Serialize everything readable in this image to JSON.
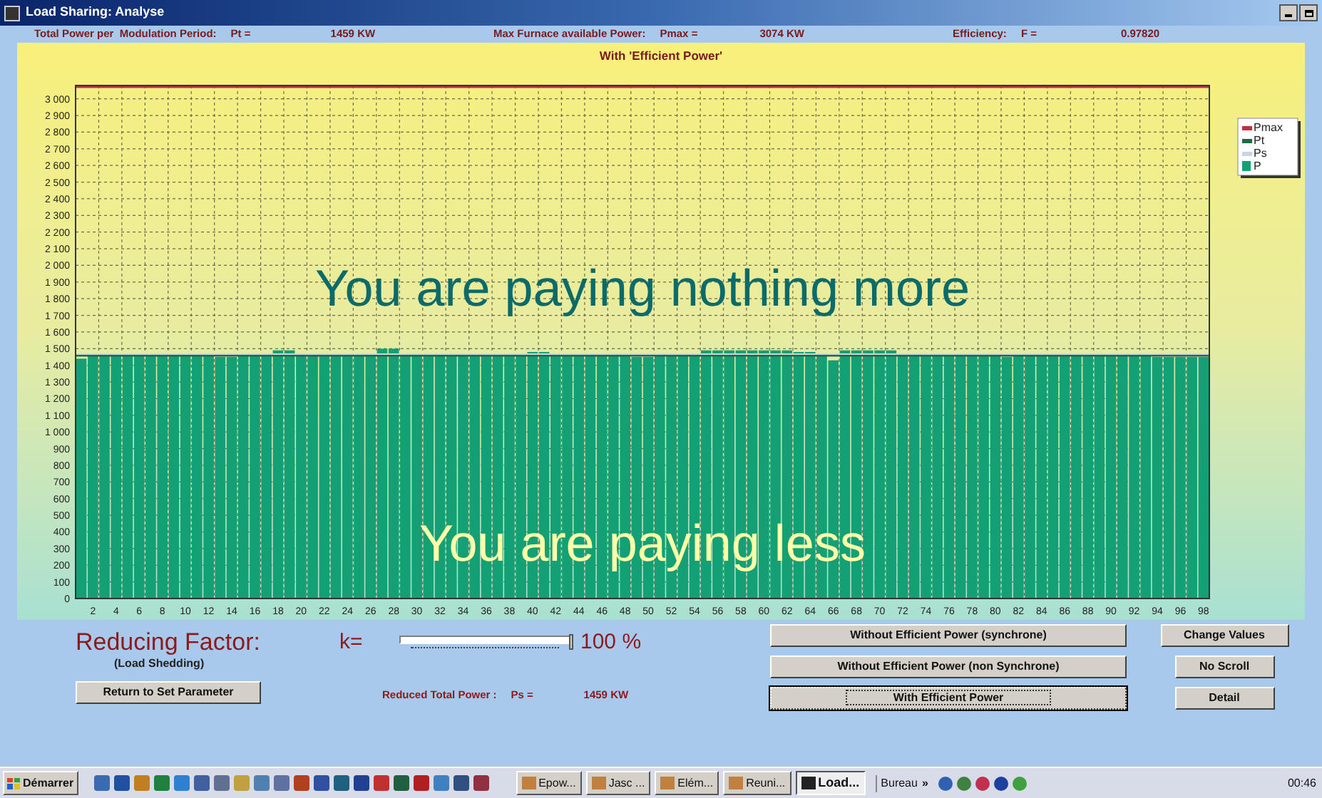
{
  "window": {
    "title": "Load Sharing: Analyse"
  },
  "summary": [
    {
      "label": "Total Power per  Modulation Period:",
      "symbol": "Pt =",
      "value": "1459 KW"
    },
    {
      "label": "Max Furnace available Power:",
      "symbol": "Pmax =",
      "value": "3074 KW"
    },
    {
      "label": "Efficiency:",
      "symbol": "F =",
      "value": "0.97820"
    }
  ],
  "chart": {
    "chart_data": {
      "type": "bar",
      "title": "With 'Efficient Power'",
      "x": [
        1,
        2,
        3,
        4,
        5,
        6,
        7,
        8,
        9,
        10,
        11,
        12,
        13,
        14,
        15,
        16,
        17,
        18,
        19,
        20,
        21,
        22,
        23,
        24,
        25,
        26,
        27,
        28,
        29,
        30,
        31,
        32,
        33,
        34,
        35,
        36,
        37,
        38,
        39,
        40,
        41,
        42,
        43,
        44,
        45,
        46,
        47,
        48,
        49,
        50,
        51,
        52,
        53,
        54,
        55,
        56,
        57,
        58,
        59,
        60,
        61,
        62,
        63,
        64,
        65,
        66,
        67,
        68,
        69,
        70,
        71,
        72,
        73,
        74,
        75,
        76,
        77,
        78,
        79,
        80,
        81,
        82,
        83,
        84,
        85,
        86,
        87,
        88,
        89,
        90,
        91,
        92,
        93,
        94,
        95,
        96,
        97,
        98
      ],
      "ref_lines": [
        {
          "axis": "y",
          "value": 3074,
          "label": "Pmax",
          "color": "#c0303a"
        },
        {
          "axis": "y",
          "value": 1459,
          "label": "Pt",
          "color": "#1d6b43"
        },
        {
          "axis": "y",
          "value": 1459,
          "label": "Ps",
          "color": "#c8d4e8"
        }
      ],
      "series": [
        {
          "name": "P",
          "color": "#12a074",
          "values": [
            1440,
            1460,
            1460,
            1460,
            1460,
            1460,
            1460,
            1460,
            1460,
            1460,
            1460,
            1460,
            1450,
            1450,
            1460,
            1460,
            1460,
            1490,
            1490,
            1470,
            1470,
            1460,
            1460,
            1460,
            1460,
            1460,
            1500,
            1500,
            1470,
            1470,
            1470,
            1460,
            1460,
            1470,
            1470,
            1460,
            1460,
            1460,
            1470,
            1480,
            1480,
            1470,
            1470,
            1460,
            1460,
            1460,
            1460,
            1460,
            1450,
            1450,
            1460,
            1460,
            1460,
            1470,
            1490,
            1490,
            1490,
            1490,
            1490,
            1490,
            1490,
            1490,
            1480,
            1480,
            1470,
            1430,
            1490,
            1490,
            1490,
            1490,
            1490,
            1460,
            1460,
            1460,
            1460,
            1460,
            1460,
            1460,
            1460,
            1460,
            1450,
            1460,
            1460,
            1460,
            1460,
            1460,
            1460,
            1460,
            1460,
            1460,
            1460,
            1460,
            1460,
            1450,
            1450,
            1450,
            1450,
            1450
          ]
        }
      ],
      "xlim": [
        0.5,
        98.5
      ],
      "ylim": [
        0,
        3080
      ],
      "grid": true,
      "legend": true,
      "xticks": [
        2,
        4,
        6,
        8,
        10,
        12,
        14,
        16,
        18,
        20,
        22,
        24,
        26,
        28,
        30,
        32,
        34,
        36,
        38,
        40,
        42,
        44,
        46,
        48,
        50,
        52,
        54,
        56,
        58,
        60,
        62,
        64,
        66,
        68,
        70,
        72,
        74,
        76,
        78,
        80,
        82,
        84,
        86,
        88,
        90,
        92,
        94,
        96,
        98
      ],
      "yticks": [
        {
          "value": 0,
          "label": "0"
        },
        {
          "value": 100,
          "label": "100"
        },
        {
          "value": 200,
          "label": "200"
        },
        {
          "value": 300,
          "label": "300"
        },
        {
          "value": 400,
          "label": "400"
        },
        {
          "value": 500,
          "label": "500"
        },
        {
          "value": 600,
          "label": "600"
        },
        {
          "value": 700,
          "label": "700"
        },
        {
          "value": 800,
          "label": "800"
        },
        {
          "value": 900,
          "label": "900"
        },
        {
          "value": 1000,
          "label": "1 000"
        },
        {
          "value": 1100,
          "label": "1 100"
        },
        {
          "value": 1200,
          "label": "1 200"
        },
        {
          "value": 1300,
          "label": "1 300"
        },
        {
          "value": 1400,
          "label": "1 400"
        },
        {
          "value": 1500,
          "label": "1 500"
        },
        {
          "value": 1600,
          "label": "1 600"
        },
        {
          "value": 1700,
          "label": "1 700"
        },
        {
          "value": 1800,
          "label": "1 800"
        },
        {
          "value": 1900,
          "label": "1 900"
        },
        {
          "value": 2000,
          "label": "2 000"
        },
        {
          "value": 2100,
          "label": "2 100"
        },
        {
          "value": 2200,
          "label": "2 200"
        },
        {
          "value": 2300,
          "label": "2 300"
        },
        {
          "value": 2400,
          "label": "2 400"
        },
        {
          "value": 2500,
          "label": "2 500"
        },
        {
          "value": 2600,
          "label": "2 600"
        },
        {
          "value": 2700,
          "label": "2 700"
        },
        {
          "value": 2800,
          "label": "2 800"
        },
        {
          "value": 2900,
          "label": "2 900"
        },
        {
          "value": 3000,
          "label": "3 000"
        }
      ],
      "annotations": [
        "You are paying nothing more",
        "You are paying less"
      ]
    }
  },
  "reducing": {
    "label": "Reducing Factor:",
    "sublabel": "(Load Shedding)",
    "symbol": "k=",
    "level": 1,
    "reading": "100 %"
  },
  "reduced_power": {
    "label": "Reduced Total Power :",
    "symbol": "Ps =",
    "value": "1459 KW"
  },
  "return_button": "Return to Set Parameter",
  "mode_buttons": [
    {
      "label": "Without Efficient Power (synchrone)",
      "selected": false
    },
    {
      "label": "Without Efficient Power (non Synchrone)",
      "selected": false
    },
    {
      "label": "With Efficient Power",
      "selected": true
    }
  ],
  "side_buttons": [
    "Change Values",
    "No Scroll",
    "Detail"
  ],
  "taskbar": {
    "start": "Démarrer",
    "tasks": [
      {
        "label": "Epow...",
        "selected": false
      },
      {
        "label": "Jasc ...",
        "selected": false
      },
      {
        "label": "Elém...",
        "selected": false
      },
      {
        "label": "Reuni...",
        "selected": false
      },
      {
        "label": "Load...",
        "selected": true
      }
    ],
    "desktop": "Bureau",
    "more": "»",
    "clock": "00:46"
  }
}
